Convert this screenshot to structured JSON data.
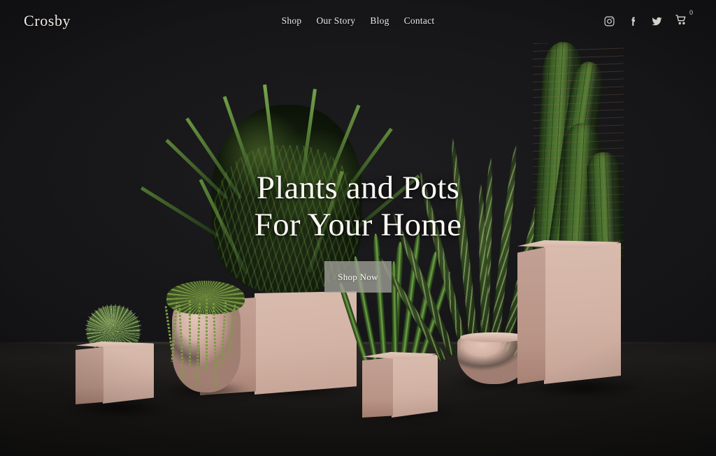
{
  "brand": {
    "name": "Crosby"
  },
  "nav": {
    "items": [
      {
        "label": "Shop"
      },
      {
        "label": "Our Story"
      },
      {
        "label": "Blog"
      },
      {
        "label": "Contact"
      }
    ]
  },
  "actions": {
    "instagram_icon": "instagram-icon",
    "facebook_icon": "facebook-icon",
    "twitter_icon": "twitter-icon",
    "cart_icon": "shopping-cart-icon",
    "cart_count": "0"
  },
  "hero": {
    "headline_line1": "Plants and Pots",
    "headline_line2": "For Your Home",
    "cta_label": "Shop Now"
  },
  "scene": {
    "description": "Studio photograph of six blush-pink planters on a dark floor against a black wall",
    "items": [
      {
        "name": "barrel-cactus-in-cube-planter"
      },
      {
        "name": "string-of-pearls-in-round-vase"
      },
      {
        "name": "parlor-palm-in-tall-cube-planter"
      },
      {
        "name": "cylindrical-snake-plant-in-cube-planter"
      },
      {
        "name": "snake-plant-in-round-pot"
      },
      {
        "name": "columnar-cactus-in-pedestal-planter"
      }
    ]
  },
  "colors": {
    "background": "#121214",
    "pot_light": "#d9bcae",
    "pot_shade": "#b89486",
    "foliage": "#3d5a28",
    "text": "#fbf8f4",
    "cta_background": "#9e9e96"
  }
}
